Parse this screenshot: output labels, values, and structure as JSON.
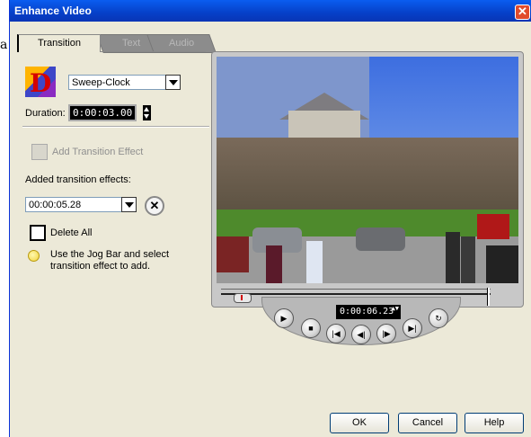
{
  "background": {
    "text": "a"
  },
  "window": {
    "title": "Enhance Video",
    "close_glyph": "✕"
  },
  "tabs": [
    {
      "label": "Transition"
    },
    {
      "label": "Text"
    },
    {
      "label": "Audio"
    }
  ],
  "transition": {
    "logo_letter": "D",
    "type_value": "Sweep-Clock",
    "duration_label": "Duration:",
    "duration_value": "0:00:03.00",
    "add_effect_label": "Add Transition Effect",
    "added_label": "Added transition effects:",
    "added_value": "00:00:05.28",
    "remove_glyph": "✕",
    "delete_all_label": "Delete All",
    "hint_line1": "Use the Jog Bar and select",
    "hint_line2": "transition effect to add."
  },
  "player": {
    "counter": "0:00:06.23",
    "counter_arrows": "▲▼",
    "controls": {
      "play": "▶",
      "stop": "■",
      "home": "|◀",
      "prev": "◀|",
      "next": "|▶",
      "end": "▶|",
      "repeat": "↻"
    }
  },
  "buttons": {
    "ok": "OK",
    "cancel": "Cancel",
    "help": "Help"
  },
  "icons": [
    "close-icon",
    "dropdown-arrow-icon",
    "spin-arrows-icon",
    "add-effect-icon",
    "remove-x-icon",
    "delete-all-icon",
    "lightbulb-icon",
    "play-icon",
    "stop-icon",
    "home-icon",
    "prev-frame-icon",
    "next-frame-icon",
    "end-icon",
    "repeat-icon"
  ],
  "colors": {
    "titlebar": "#0a5df0",
    "dialog_bg": "#ece9d8",
    "close": "#e14b2c"
  }
}
